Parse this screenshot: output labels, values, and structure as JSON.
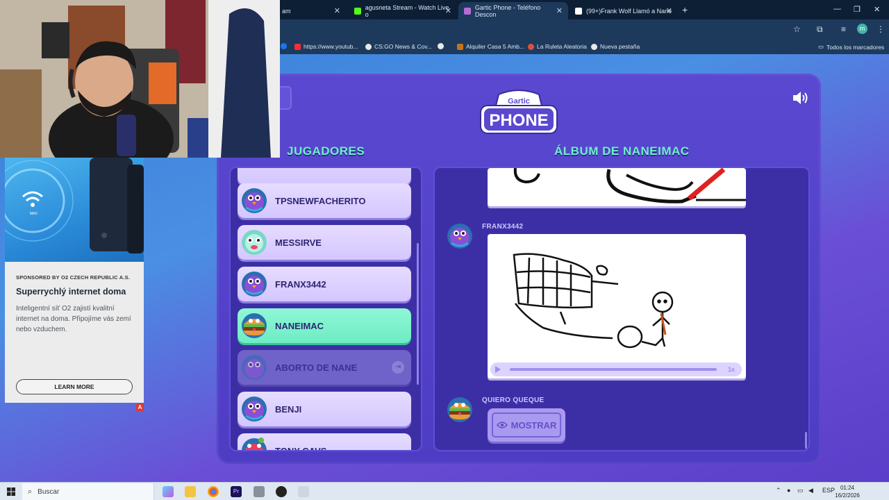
{
  "browser": {
    "tabs": [
      {
        "title": "am",
        "icon_color": "#9aa7b8"
      },
      {
        "title": "agusneta Stream - Watch Live o",
        "icon_color": "#53fc18"
      },
      {
        "title": "Gartic Phone - Teléfono Descon",
        "icon_color": "#b96ad9"
      },
      {
        "title": "(99+)Frank Wolf Llamó a Nane",
        "icon_color": "#ffffff"
      }
    ],
    "bookmarks": [
      {
        "label": "https://www.youtub...",
        "icon_color": "#ff2d2d"
      },
      {
        "label": "CS:GO News & Cov...",
        "icon_color": "#e8e8e8"
      },
      {
        "label": "",
        "icon_color": "#e8e8e8"
      },
      {
        "label": "Alquiler Casa 5 Amb...",
        "icon_color": "#c7731c"
      },
      {
        "label": "La Ruleta Aleatoria",
        "icon_color": "#e0503c"
      },
      {
        "label": "Nueva pestaña",
        "icon_color": "#e8e8e8"
      }
    ],
    "all_bookmarks": "Todos los marcadores",
    "profile_initial": "m"
  },
  "game": {
    "logo_top": "Gartic",
    "logo_main": "PHONE",
    "players_title": "JUGADORES",
    "album_title": "ÁLBUM DE NANEIMAC",
    "players": [
      {
        "name": "TPSNEWFACHERITO",
        "state": "normal",
        "avatar": "purple"
      },
      {
        "name": "MESSIRVE",
        "state": "normal",
        "avatar": "teal"
      },
      {
        "name": "FRANX3442",
        "state": "normal",
        "avatar": "purple"
      },
      {
        "name": "NANEIMAC",
        "state": "active",
        "avatar": "burger"
      },
      {
        "name": "ABORTO DE NANE",
        "state": "dim",
        "avatar": "purple"
      },
      {
        "name": "BENJI",
        "state": "normal",
        "avatar": "purple"
      },
      {
        "name": "TONY CAVS",
        "state": "normal",
        "avatar": "mushroom"
      }
    ],
    "album": {
      "entry1_author": "FRANX3442",
      "playback_speed": "1x",
      "entry2_author": "QUIERO QUEQUE",
      "show_button": "MOSTRAR"
    }
  },
  "ad": {
    "sponsor": "SPONSORED BY O2 CZECH REPUBLIC A.S.",
    "headline": "Superrychlý internet doma",
    "body": "Inteligentní síť O2 zajistí kvalitní internet na doma. Připojíme vás zemí nebo vzduchem.",
    "cta": "LEARN MORE",
    "badge": "A",
    "device_label": "MAX"
  },
  "taskbar": {
    "search_placeholder": "Buscar",
    "language": "ESP",
    "time": "01:24",
    "date": "16/2/2026"
  }
}
